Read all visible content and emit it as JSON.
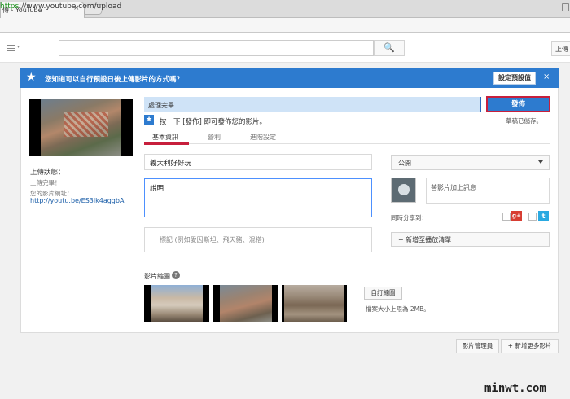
{
  "browser": {
    "tab_title": "傳 - YouTube",
    "tab_close": "×",
    "url_protocol": "https",
    "url_rest": "://www.youtube.com/upload"
  },
  "header": {
    "menu_arrow": "▾",
    "search_icon": "search-icon",
    "search_glyph": "🔍",
    "upload_label": "上傳"
  },
  "banner": {
    "star": "★",
    "text": "您知道可以自行預設日後上傳影片的方式嗎？",
    "button_label": "設定預設值",
    "close": "×"
  },
  "left": {
    "status_label": "上傳狀態：",
    "status_value": "上傳完畢！",
    "url_label": "您的影片網址：",
    "url": "http://youtu.be/ES3lk4aggbA"
  },
  "processing": {
    "text": "處理完畢",
    "publish_label": "發佈"
  },
  "hint": {
    "star": "★",
    "text": "按一下 [發佈] 即可發佈您的影片。",
    "draft": "草稿已儲存。"
  },
  "tabs": [
    {
      "label": "基本資訊"
    },
    {
      "label": "營利"
    },
    {
      "label": "進階設定"
    }
  ],
  "form": {
    "title_value": "義大利好好玩",
    "description_value": "說明",
    "tags_placeholder": "標記 (例如愛因斯坦、飛天豬、混搭)",
    "privacy_value": "公開",
    "message_placeholder": "替影片加上訊息",
    "share_label": "同時分享到：",
    "playlist_label": "+ 新增至播放清單"
  },
  "social": {
    "gplus": "g+",
    "twitter": "t"
  },
  "thumbnails": {
    "label": "影片縮圖",
    "help": "?",
    "custom_label": "自訂縮圖",
    "max_size": "檔案大小上限為 2MB。"
  },
  "footer": {
    "video_manager": "影片管理員",
    "add_more": "+ 新增更多影片"
  },
  "watermark": "minwt.com",
  "colors": {
    "accent_blue": "#2d7bcf",
    "highlight_red": "#c71f3c",
    "link_blue": "#1b5ea8"
  }
}
